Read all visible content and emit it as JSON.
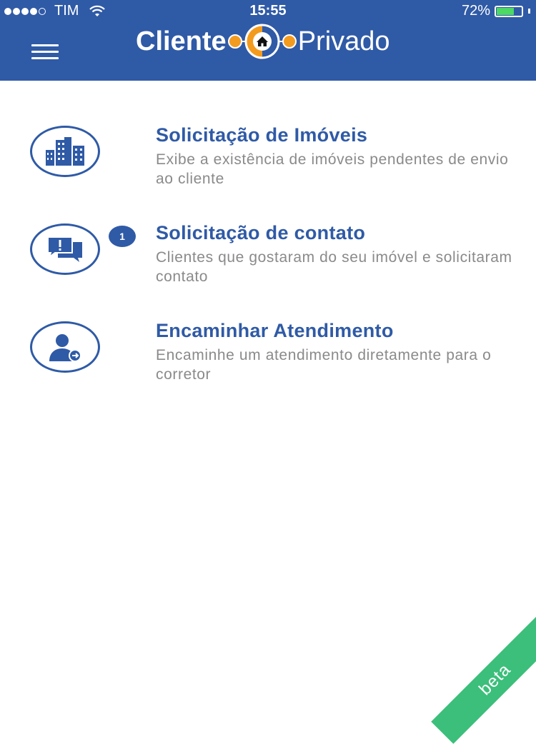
{
  "status_bar": {
    "carrier": "TIM",
    "time": "15:55",
    "battery_percent_label": "72%",
    "battery_level": 0.72
  },
  "header": {
    "logo_left": "Cliente",
    "logo_right": "Privado"
  },
  "items": [
    {
      "title": "Solicitação de Imóveis",
      "description": "Exibe a existência de imóveis pendentes de envio ao cliente",
      "icon": "buildings-icon"
    },
    {
      "title": "Solicitação de contato",
      "description": "Clientes que gostaram do seu imóvel e solicitaram contato",
      "icon": "chat-icon",
      "badge": "1"
    },
    {
      "title": "Encaminhar Atendimento",
      "description": "Encaminhe um atendimento diretamente para o corretor",
      "icon": "user-forward-icon"
    }
  ],
  "ribbon": {
    "label": "beta"
  },
  "colors": {
    "primary": "#2f5aa6",
    "accent_orange": "#f39b1e",
    "ribbon_green": "#3bbf7a"
  }
}
